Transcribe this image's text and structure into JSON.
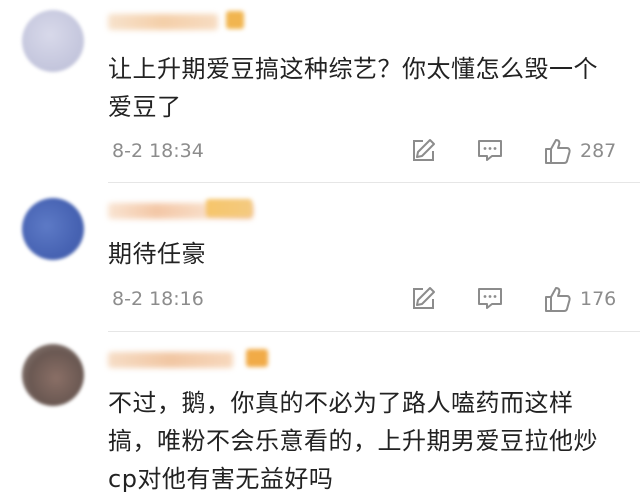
{
  "comments": [
    {
      "text": "让上升期爱豆搞这种综艺？你太懂怎么毁一个爱豆了",
      "time": "8-2 18:34",
      "likes": "287",
      "avatar_color": "#c9cbe0",
      "name_color": "#f4c9a0",
      "badge_color": "#f0b24a"
    },
    {
      "text": "期待任豪",
      "time": "8-2 18:16",
      "likes": "176",
      "avatar_color": "#4b68b8",
      "name_color": "#f3c9a8",
      "badge_color": "#f0b24a"
    },
    {
      "text": "不过，鹅，你真的不必为了路人嗑药而这样搞，唯粉不会乐意看的，上升期男爱豆拉他炒cp对他有害无益好吗",
      "time": "",
      "likes": "",
      "avatar_color": "#7a6a62",
      "name_color": "#f1c7a3",
      "badge_color": "#f0a845"
    }
  ],
  "icons": {
    "share": "share-icon",
    "comment": "comment-icon",
    "like": "thumbs-up-icon"
  },
  "colors": {
    "meta_text": "#8c8c8c",
    "divider": "#e6e6e6"
  }
}
